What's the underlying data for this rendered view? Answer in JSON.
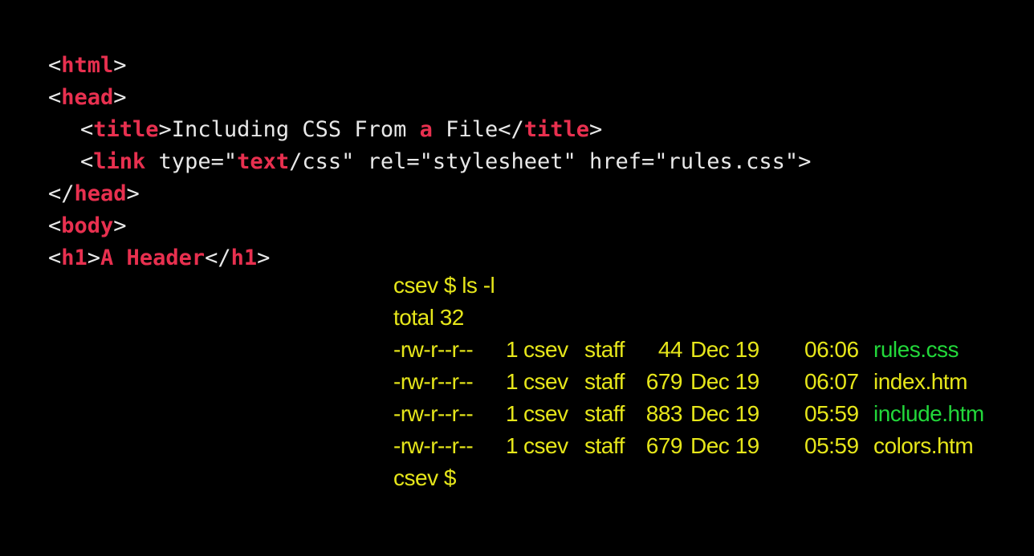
{
  "code": {
    "lines": [
      {
        "id": "l1",
        "indent": 0,
        "parts": [
          [
            "plain",
            "<"
          ],
          [
            "tag",
            "html"
          ],
          [
            "plain",
            ">"
          ]
        ]
      },
      {
        "id": "l2",
        "indent": 0,
        "parts": [
          [
            "plain",
            "<"
          ],
          [
            "tag",
            "head"
          ],
          [
            "plain",
            ">"
          ]
        ]
      },
      {
        "id": "l3",
        "indent": 1,
        "parts": [
          [
            "plain",
            "<"
          ],
          [
            "tag",
            "title"
          ],
          [
            "plain",
            ">Including CSS From "
          ],
          [
            "kw",
            "a"
          ],
          [
            "plain",
            " File</"
          ],
          [
            "tag",
            "title"
          ],
          [
            "plain",
            ">"
          ]
        ]
      },
      {
        "id": "l4",
        "indent": 1,
        "parts": [
          [
            "plain",
            "<"
          ],
          [
            "tag",
            "link"
          ],
          [
            "plain",
            " type=\""
          ],
          [
            "kw",
            "text"
          ],
          [
            "plain",
            "/css\" rel=\"stylesheet\" href=\"rules.css\">"
          ]
        ]
      },
      {
        "id": "l5",
        "indent": 0,
        "parts": [
          [
            "plain",
            "</"
          ],
          [
            "tag",
            "head"
          ],
          [
            "plain",
            ">"
          ]
        ]
      },
      {
        "id": "l6",
        "indent": 0,
        "parts": [
          [
            "plain",
            "<"
          ],
          [
            "tag",
            "body"
          ],
          [
            "plain",
            ">"
          ]
        ]
      },
      {
        "id": "l7",
        "indent": 0,
        "parts": [
          [
            "plain",
            "<"
          ],
          [
            "tag",
            "h1"
          ],
          [
            "plain",
            ">"
          ],
          [
            "tag",
            "A Header"
          ],
          [
            "plain",
            "</"
          ],
          [
            "tag",
            "h1"
          ],
          [
            "plain",
            ">"
          ]
        ]
      }
    ]
  },
  "terminal": {
    "prompt_command": "csev $ ls -l",
    "total": "total 32",
    "rows": [
      {
        "perm": "-rw-r--r--",
        "links": "1",
        "owner": "csev",
        "group": "staff",
        "size": "44",
        "date": "Dec 19",
        "time": "06:06",
        "name": "rules.css",
        "highlighted": true
      },
      {
        "perm": "-rw-r--r--",
        "links": "1",
        "owner": "csev",
        "group": "staff",
        "size": "679",
        "date": "Dec 19",
        "time": "06:07",
        "name": "index.htm",
        "highlighted": false
      },
      {
        "perm": "-rw-r--r--",
        "links": "1",
        "owner": "csev",
        "group": "staff",
        "size": "883",
        "date": "Dec 19",
        "time": "05:59",
        "name": "include.htm",
        "highlighted": true
      },
      {
        "perm": "-rw-r--r--",
        "links": "1",
        "owner": "csev",
        "group": "staff",
        "size": "679",
        "date": "Dec 19",
        "time": "05:59",
        "name": "colors.htm",
        "highlighted": false
      }
    ],
    "final_prompt": "csev $"
  },
  "colors": {
    "background": "#000000",
    "tag": "#e8304f",
    "code_text": "#e8e8e8",
    "terminal_text": "#e6e61a",
    "highlight_file": "#22d83a"
  }
}
